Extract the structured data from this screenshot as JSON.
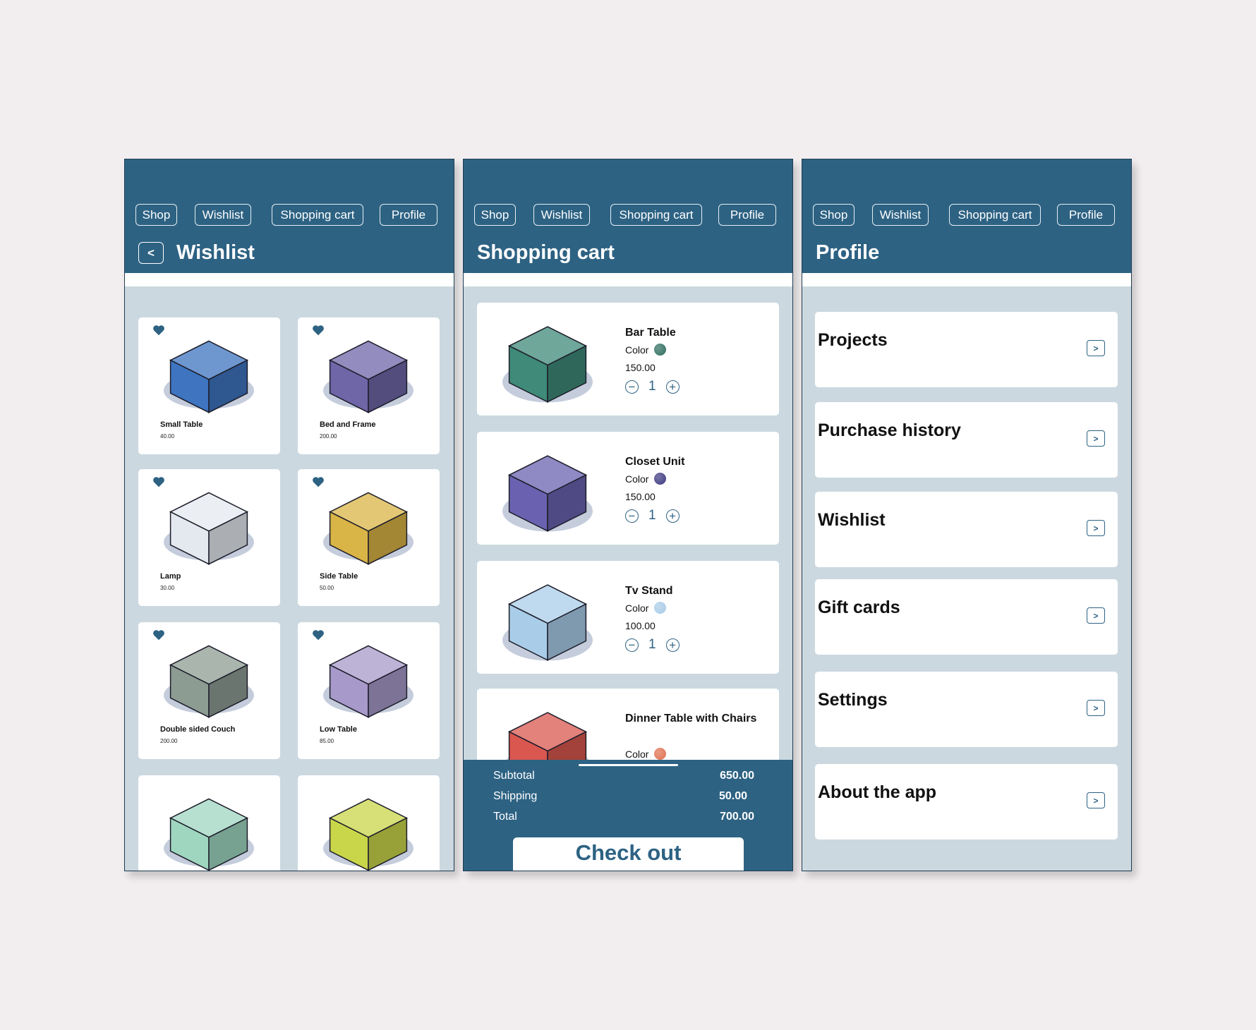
{
  "nav": [
    "Shop",
    "Wishlist",
    "Shopping cart",
    "Profile"
  ],
  "colors": {
    "header": "#2d6283",
    "content": "#cbd8e0",
    "heart": "#2d6283"
  },
  "wishlist": {
    "back_label": "<",
    "title": "Wishlist",
    "items": [
      {
        "name": "Small Table",
        "price": "40.00",
        "color": "#3e74c0"
      },
      {
        "name": "Bed and Frame",
        "price": "200.00",
        "color": "#6f66a8"
      },
      {
        "name": "Lamp",
        "price": "30.00",
        "color": "#e4e8ef"
      },
      {
        "name": "Side Table",
        "price": "50.00",
        "color": "#d9b446"
      },
      {
        "name": "Double sided Couch",
        "price": "200.00",
        "color": "#8c9c92"
      },
      {
        "name": "Low Table",
        "price": "85.00",
        "color": "#a799c9"
      },
      {
        "name": "",
        "price": "",
        "color": "#9fd6c0"
      },
      {
        "name": "",
        "price": "",
        "color": "#c9d64a"
      }
    ]
  },
  "cart": {
    "title": "Shopping cart",
    "color_label": "Color",
    "items": [
      {
        "name": "Bar Table",
        "color": "#2f6d5f",
        "price": "150.00",
        "qty": "1",
        "img": "#3f8a78"
      },
      {
        "name": "Closet Unit",
        "color": "#3d3a80",
        "price": "150.00",
        "qty": "1",
        "img": "#6a62b0"
      },
      {
        "name": "Tv Stand",
        "color": "#a8cbe6",
        "price": "100.00",
        "qty": "1",
        "img": "#a9cde8"
      },
      {
        "name": "Dinner Table with Chairs",
        "color": "#e07050",
        "price": "",
        "qty": "",
        "img": "#d9574f"
      }
    ],
    "summary": [
      {
        "label": "Subtotal",
        "value": "650.00"
      },
      {
        "label": "Shipping",
        "value": "50.00"
      },
      {
        "label": "Total",
        "value": "700.00"
      }
    ],
    "checkout_label": "Check out"
  },
  "profile": {
    "title": "Profile",
    "arrow": ">",
    "items": [
      "Projects",
      "Purchase history",
      "Wishlist",
      "Gift cards",
      "Settings",
      "About the app"
    ]
  }
}
